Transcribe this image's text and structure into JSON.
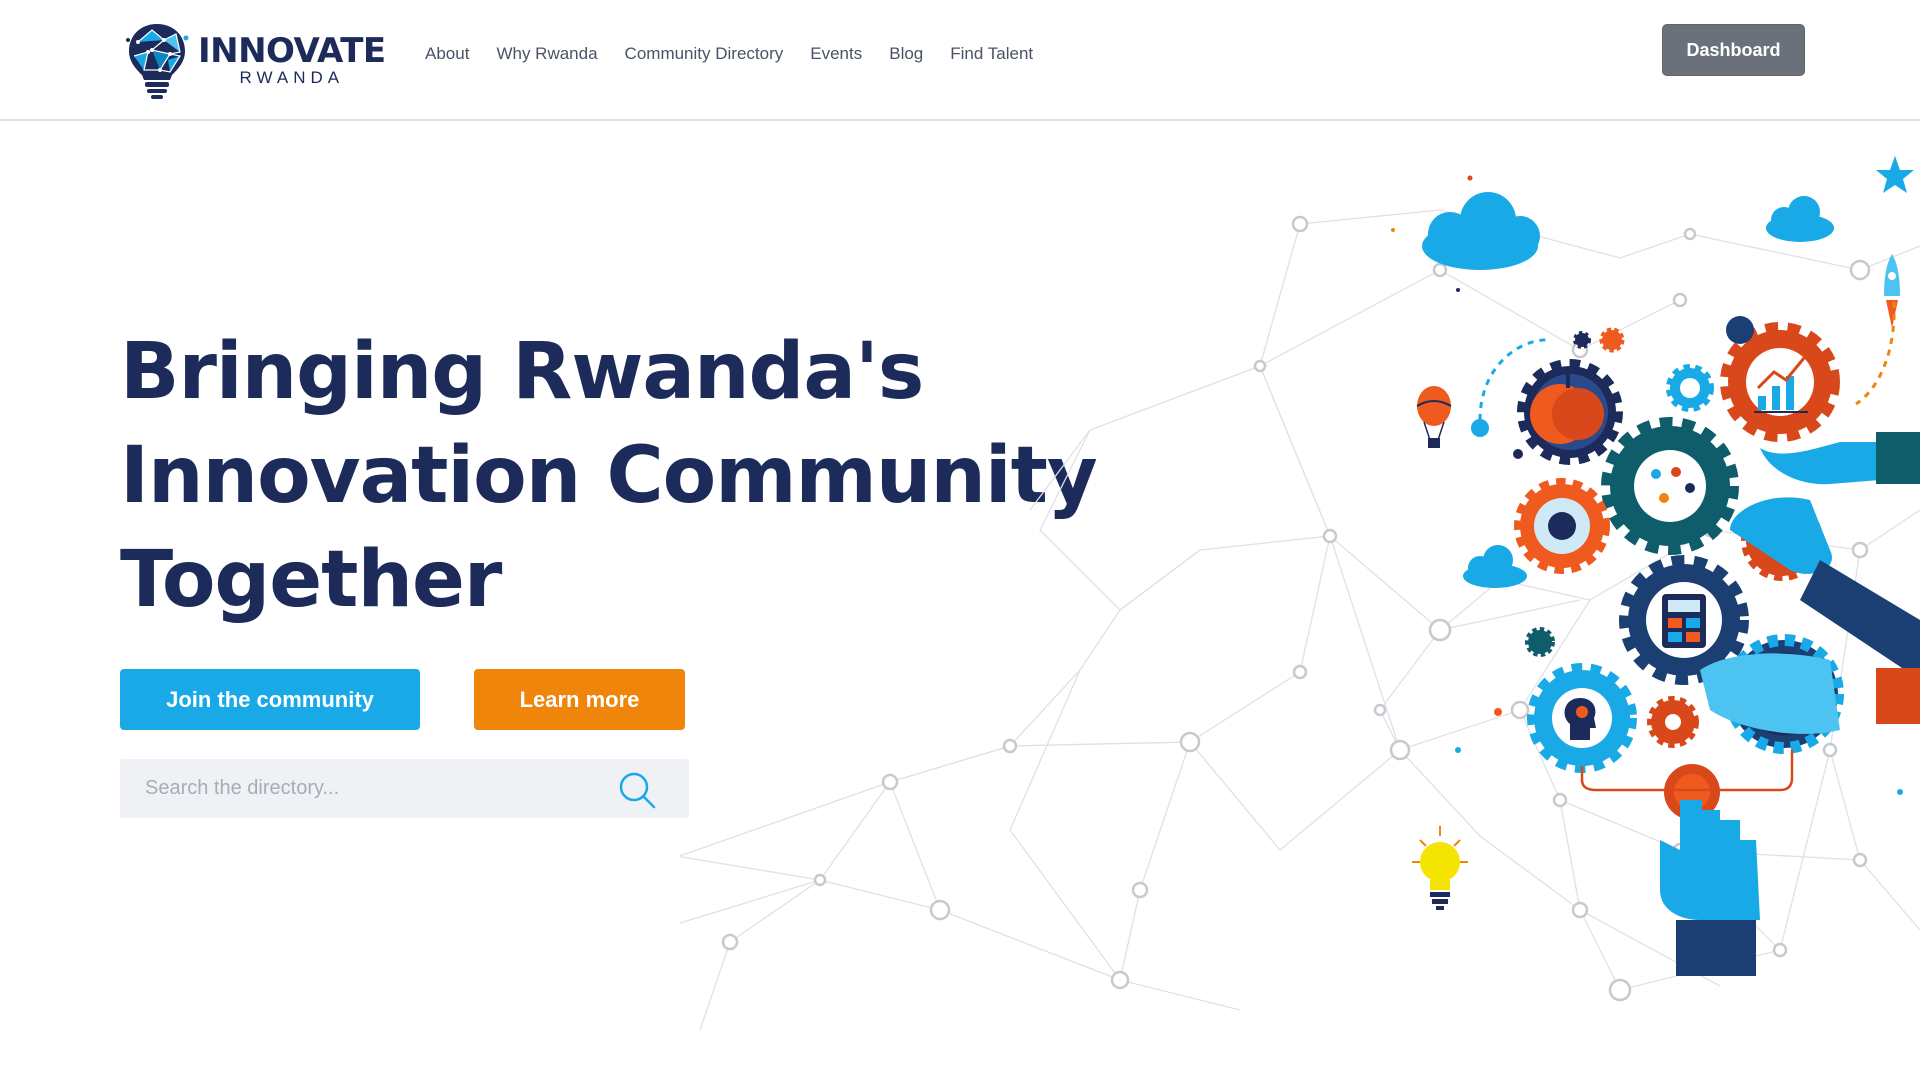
{
  "brand": {
    "name": "INNOVATE",
    "subname": "RWANDA",
    "colors": {
      "navy": "#1c2b5a",
      "cyan": "#19a9e6",
      "orange": "#ef850b",
      "gray_button": "#6b717b"
    }
  },
  "nav": {
    "items": [
      {
        "label": "About"
      },
      {
        "label": "Why Rwanda"
      },
      {
        "label": "Community Directory"
      },
      {
        "label": "Events"
      },
      {
        "label": "Blog"
      },
      {
        "label": "Find Talent"
      }
    ],
    "dashboard_label": "Dashboard"
  },
  "hero": {
    "title_lines": [
      "Bringing Rwanda's",
      "Innovation Community",
      "Together"
    ],
    "join_label": "Join the community",
    "learn_label": "Learn more"
  },
  "search": {
    "placeholder": "Search the directory...",
    "value": "",
    "icon": "search-icon"
  },
  "illustration": {
    "icons": [
      "network-graph",
      "cloud-icon",
      "gear-icon",
      "apple-icon",
      "chart-icon",
      "calculator-icon",
      "clock-icon",
      "head-gear-icon",
      "globe-icon",
      "hand-icon",
      "lightbulb-icon",
      "rocket-icon",
      "hot-air-balloon-icon",
      "star-icon"
    ]
  }
}
